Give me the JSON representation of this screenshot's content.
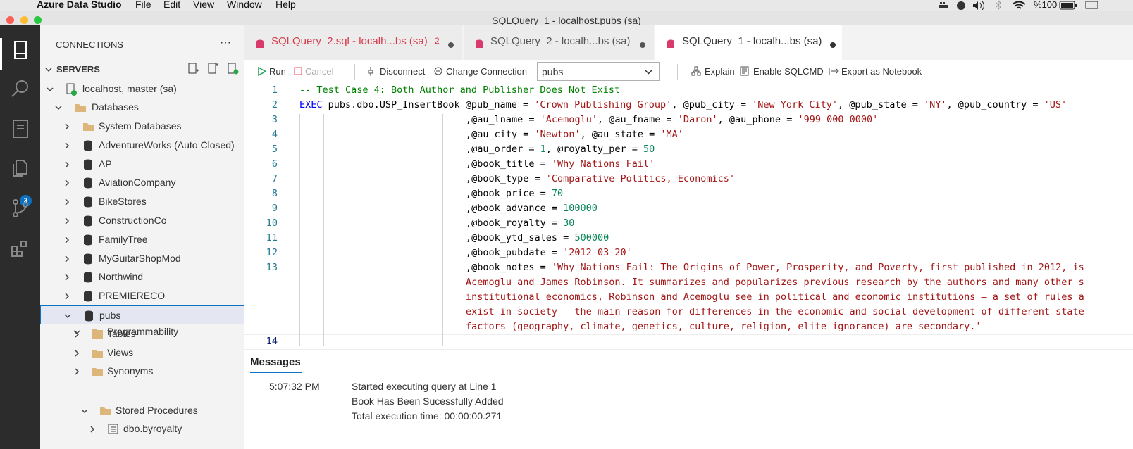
{
  "menubar": {
    "app": "Azure Data Studio",
    "menus": [
      "File",
      "Edit",
      "View",
      "Window",
      "Help"
    ],
    "battery": "%100"
  },
  "window": {
    "title": "SQLQuery_1 - localhost.pubs (sa)"
  },
  "activity": {
    "badge": "3"
  },
  "sidebar": {
    "title": "CONNECTIONS",
    "more": "···",
    "section": "SERVERS",
    "server": "localhost, master (sa)",
    "databases_label": "Databases",
    "items": [
      "System Databases",
      "AdventureWorks (Auto Closed)",
      "AP",
      "AviationCompany",
      "BikeStores",
      "ConstructionCo",
      "FamilyTree",
      "MyGuitarShopMod",
      "Northwind",
      "PREMIERECO",
      "pubs"
    ],
    "pubs_children": [
      "Tables",
      "Views",
      "Synonyms",
      "Programmability"
    ],
    "stored_procedures": "Stored Procedures",
    "proc": "dbo.byroyalty"
  },
  "tabs": [
    {
      "label": "SQLQuery_2.sql - localh...bs (sa)",
      "count": "2"
    },
    {
      "label": "SQLQuery_2 - localh...bs (sa)"
    },
    {
      "label": "SQLQuery_1 - localh...bs (sa)"
    }
  ],
  "toolbar": {
    "run": "Run",
    "cancel": "Cancel",
    "disconnect": "Disconnect",
    "change_connection": "Change Connection",
    "database": "pubs",
    "explain": "Explain",
    "sqlcmd": "Enable SQLCMD",
    "export": "Export as Notebook"
  },
  "editor": {
    "line_numbers": [
      "1",
      "2",
      "3",
      "4",
      "5",
      "6",
      "7",
      "8",
      "9",
      "10",
      "11",
      "12",
      "13",
      "14"
    ],
    "lines": [
      "-- Test Case 4: Both Author and Publisher Does Not Exist",
      "EXEC pubs.dbo.USP_InsertBook @pub_name = 'Crown Publishing Group', @pub_city = 'New York City', @pub_state = 'NY', @pub_country = 'US'",
      ",@au_lname = 'Acemoglu', @au_fname = 'Daron', @au_phone = '999 000-0000'",
      ",@au_city = 'Newton', @au_state = 'MA'",
      ",@au_order = 1, @royalty_per = 50",
      ",@book_title = 'Why Nations Fail'",
      ",@book_type = 'Comparative Politics, Economics'",
      ",@book_price = 70",
      ",@book_advance = 100000",
      ",@book_royalty = 30",
      ",@book_ytd_sales = 500000",
      ",@book_pubdate = '2012-03-20'",
      ",@book_notes = 'Why Nations Fail: The Origins of Power, Prosperity, and Poverty, first published in 2012, is",
      "Acemoglu and James Robinson. It summarizes and popularizes previous research by the authors and many other s",
      "institutional economics, Robinson and Acemoglu see in political and economic institutions — a set of rules a",
      "exist in society — the main reason for differences in the economic and social development of different state",
      "factors (geography, climate, genetics, culture, religion, elite ignorance) are secondary.'"
    ]
  },
  "messages": {
    "title": "Messages",
    "time": "5:07:32 PM",
    "link": "Started executing query at Line 1",
    "result": "Book Has Been Sucessfully Added",
    "exec_time": "Total execution time: 00:00:00.271"
  }
}
